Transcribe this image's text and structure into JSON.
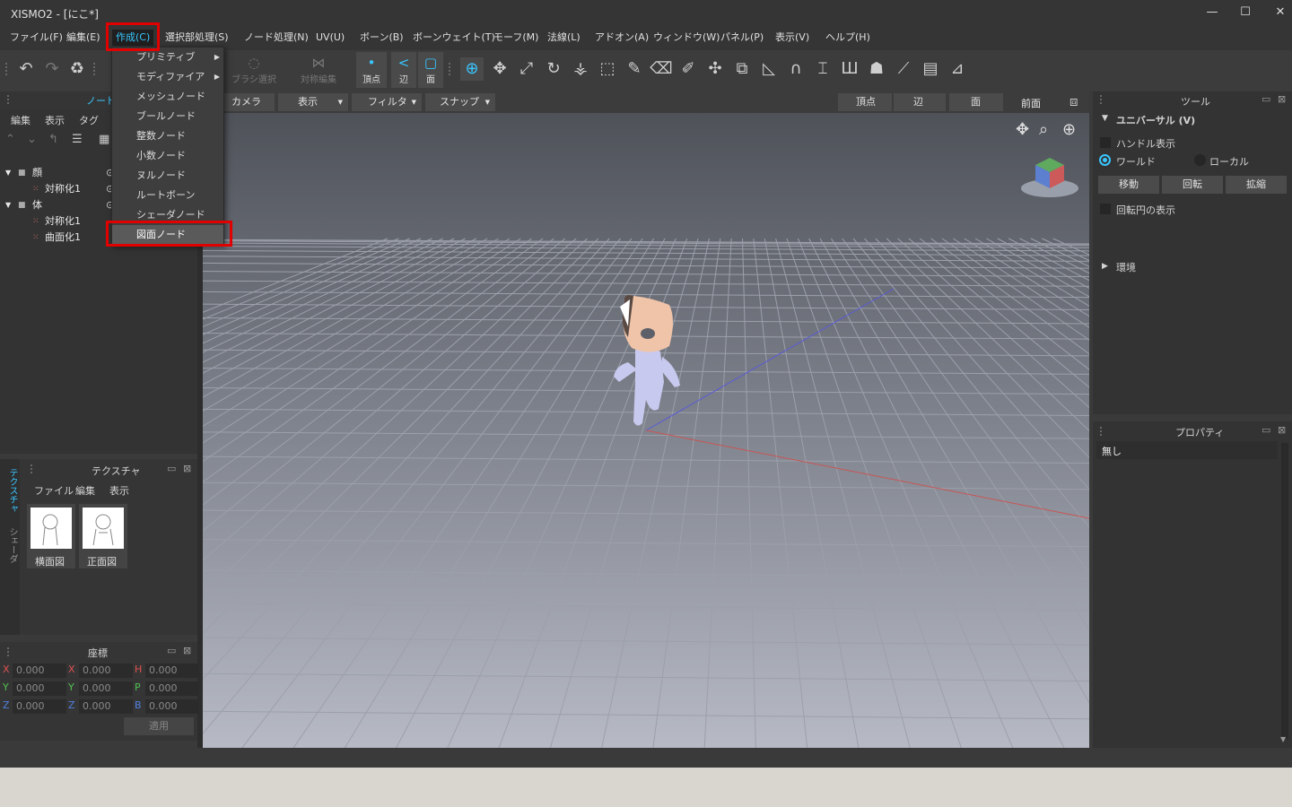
{
  "window": {
    "title": "XISMO2 - [にこ*]",
    "minimize": "—",
    "maximize": "☐",
    "close": "✕"
  },
  "menubar": {
    "items": [
      "ファイル(F)",
      "編集(E)",
      "作成(C)",
      "選択部処理(S)",
      "ノード処理(N)",
      "UV(U)",
      "ボーン(B)",
      "ボーンウェイト(T)",
      "モーフ(M)",
      "法線(L)",
      "アドオン(A)",
      "ウィンドウ(W)",
      "パネル(P)",
      "表示(V)",
      "ヘルプ(H)"
    ]
  },
  "create_menu": {
    "items": [
      "プリミティブ",
      "モディファイア",
      "メッシュノード",
      "ブールノード",
      "整数ノード",
      "小数ノード",
      "ヌルノード",
      "ルートボーン",
      "シェーダノード",
      "図面ノード"
    ],
    "has_submenu": [
      true,
      true,
      false,
      false,
      false,
      false,
      false,
      false,
      false,
      false
    ],
    "highlighted": "図面ノード"
  },
  "toolbar": {
    "brush_select": "ブラシ選択",
    "symmetric_edit": "対称編集",
    "vertex": "頂点",
    "edge": "辺",
    "face": "面"
  },
  "node_panel": {
    "title": "ノード",
    "menu": [
      "編集",
      "表示",
      "タグ"
    ],
    "tree": [
      {
        "label": "顔",
        "level": 0,
        "expanded": true
      },
      {
        "label": "対称化1",
        "level": 1
      },
      {
        "label": "体",
        "level": 0,
        "expanded": true
      },
      {
        "label": "対称化1",
        "level": 1
      },
      {
        "label": "曲面化1",
        "level": 1
      }
    ]
  },
  "texture_panel": {
    "title": "テクスチャ",
    "menu": [
      "ファイル",
      "編集",
      "表示"
    ],
    "side_tabs": [
      "テクスチャ",
      "シェーダ"
    ],
    "textures": [
      "横面図",
      "正面図"
    ]
  },
  "coord_panel": {
    "title": "座標",
    "rows": [
      {
        "a": "X",
        "av": "0.000",
        "b": "X",
        "bv": "0.000",
        "c": "H",
        "cv": "0.000"
      },
      {
        "a": "Y",
        "av": "0.000",
        "b": "Y",
        "bv": "0.000",
        "c": "P",
        "cv": "0.000"
      },
      {
        "a": "Z",
        "av": "0.000",
        "b": "Z",
        "bv": "0.000",
        "c": "B",
        "cv": "0.000"
      }
    ],
    "apply": "適用",
    "axis_colors": {
      "x": "#e05050",
      "y": "#50c050",
      "z": "#5080e0"
    }
  },
  "viewport_bar": {
    "camera": "カメラ",
    "display": "表示",
    "filter": "フィルタ",
    "snap": "スナップ",
    "vertex": "頂点",
    "edge": "辺",
    "face": "面",
    "view": "前面"
  },
  "tool_panel": {
    "title": "ツール",
    "section": "ユニバーサル (V)",
    "handle_display": "ハンドル表示",
    "world": "ワールド",
    "local": "ローカル",
    "buttons": [
      "移動",
      "回転",
      "拡縮"
    ],
    "rotation_circle": "回転円の表示",
    "environment": "環境"
  },
  "property_panel": {
    "title": "プロパティ",
    "value": "無し"
  },
  "colors": {
    "accent": "#39c6ff",
    "highlight_red": "#e00000"
  }
}
